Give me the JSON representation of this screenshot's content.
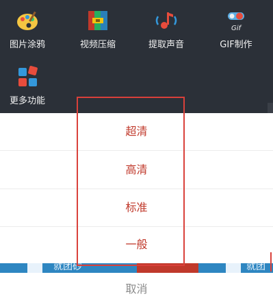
{
  "tools": [
    {
      "label": "图片涂鸦",
      "icon": "palette-icon"
    },
    {
      "label": "视频压缩",
      "icon": "archive-icon"
    },
    {
      "label": "提取声音",
      "icon": "music-note-icon"
    },
    {
      "label": "GIF制作",
      "icon": "gif-toggle-icon"
    },
    {
      "label": "更多功能",
      "icon": "more-tiles-icon"
    }
  ],
  "gif_badge": "Gif",
  "sheet": {
    "options": [
      "超清",
      "高清",
      "标准",
      "一般"
    ],
    "cancel_label": "取消"
  },
  "background_strip": {
    "text_left": "就团砂",
    "text_right": "就团"
  },
  "colors": {
    "panel_bg": "#2b3038",
    "option_text": "#c0392b",
    "cancel_text": "#8a8a8a",
    "highlight_border": "#d9403a"
  }
}
